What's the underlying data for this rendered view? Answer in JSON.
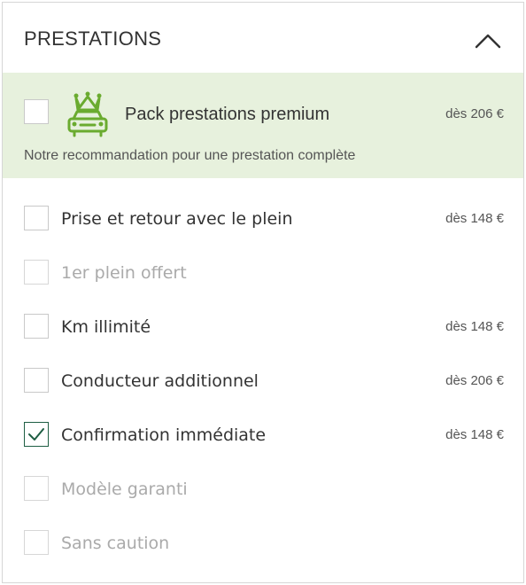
{
  "section": {
    "title": "PRESTATIONS",
    "collapse_icon": "chevron-up-icon"
  },
  "premium": {
    "label": "Pack prestations premium",
    "price": "dès 206 €",
    "description": "Notre recommandation pour une prestation complète",
    "icon": "crowned-car-icon",
    "checked": false,
    "accent_color": "#6aab2f",
    "background_color": "#e7f1dd"
  },
  "options": [
    {
      "label": "Prise et retour avec le plein",
      "price": "dès 148 €",
      "checked": false,
      "disabled": false
    },
    {
      "label": "1er plein offert",
      "price": "",
      "checked": false,
      "disabled": true
    },
    {
      "label": "Km illimité",
      "price": "dès 148 €",
      "checked": false,
      "disabled": false
    },
    {
      "label": "Conducteur additionnel",
      "price": "dès 206 €",
      "checked": false,
      "disabled": false
    },
    {
      "label": "Confirmation immédiate",
      "price": "dès 148 €",
      "checked": true,
      "disabled": false
    },
    {
      "label": "Modèle garanti",
      "price": "",
      "checked": false,
      "disabled": true
    },
    {
      "label": "Sans caution",
      "price": "",
      "checked": false,
      "disabled": true
    }
  ],
  "colors": {
    "checkmark": "#1e5e43",
    "disabled_text": "#aaaaaa",
    "border": "#d6d6d6"
  }
}
